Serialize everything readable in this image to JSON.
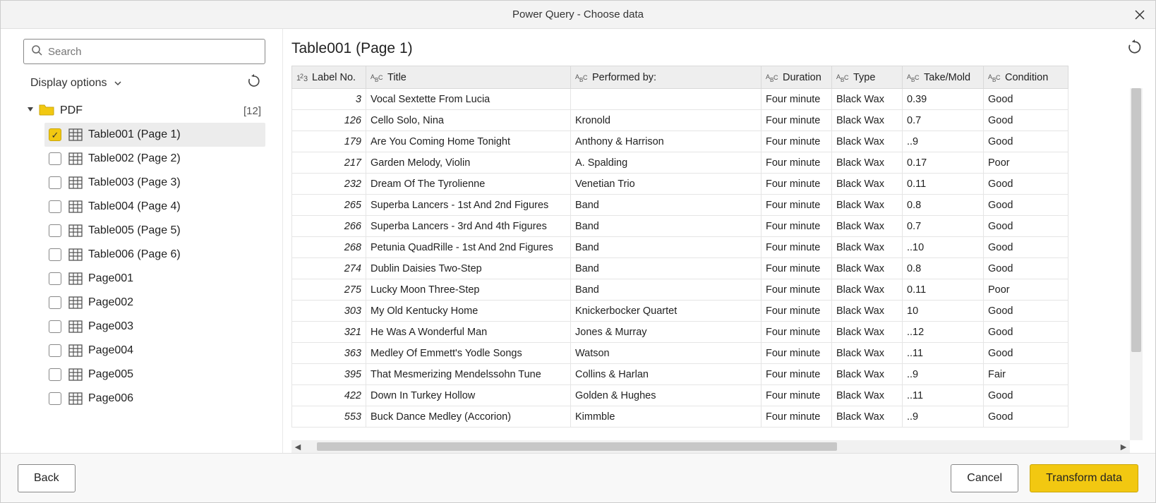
{
  "window": {
    "title": "Power Query - Choose data"
  },
  "sidebar": {
    "search_placeholder": "Search",
    "display_options_label": "Display options",
    "root": {
      "label": "PDF",
      "count": "[12]"
    },
    "items": [
      {
        "label": "Table001 (Page 1)",
        "checked": true,
        "kind": "table",
        "selected": true
      },
      {
        "label": "Table002 (Page 2)",
        "checked": false,
        "kind": "table",
        "selected": false
      },
      {
        "label": "Table003 (Page 3)",
        "checked": false,
        "kind": "table",
        "selected": false
      },
      {
        "label": "Table004 (Page 4)",
        "checked": false,
        "kind": "table",
        "selected": false
      },
      {
        "label": "Table005 (Page 5)",
        "checked": false,
        "kind": "table",
        "selected": false
      },
      {
        "label": "Table006 (Page 6)",
        "checked": false,
        "kind": "table",
        "selected": false
      },
      {
        "label": "Page001",
        "checked": false,
        "kind": "page",
        "selected": false
      },
      {
        "label": "Page002",
        "checked": false,
        "kind": "page",
        "selected": false
      },
      {
        "label": "Page003",
        "checked": false,
        "kind": "page",
        "selected": false
      },
      {
        "label": "Page004",
        "checked": false,
        "kind": "page",
        "selected": false
      },
      {
        "label": "Page005",
        "checked": false,
        "kind": "page",
        "selected": false
      },
      {
        "label": "Page006",
        "checked": false,
        "kind": "page",
        "selected": false
      }
    ]
  },
  "main": {
    "title": "Table001 (Page 1)",
    "columns": [
      {
        "label": "Label No.",
        "type": "number"
      },
      {
        "label": "Title",
        "type": "text"
      },
      {
        "label": "Performed by:",
        "type": "text"
      },
      {
        "label": "Duration",
        "type": "text"
      },
      {
        "label": "Type",
        "type": "text"
      },
      {
        "label": "Take/Mold",
        "type": "text"
      },
      {
        "label": "Condition",
        "type": "text"
      }
    ],
    "rows": [
      {
        "c0": "3",
        "c1": "Vocal Sextette From Lucia",
        "c2": "",
        "c3": "Four minute",
        "c4": "Black Wax",
        "c5": "0.39",
        "c6": "Good"
      },
      {
        "c0": "126",
        "c1": "Cello Solo, Nina",
        "c2": "Kronold",
        "c3": "Four minute",
        "c4": "Black Wax",
        "c5": "0.7",
        "c6": "Good"
      },
      {
        "c0": "179",
        "c1": "Are You Coming Home Tonight",
        "c2": "Anthony & Harrison",
        "c3": "Four minute",
        "c4": "Black Wax",
        "c5": "..9",
        "c6": "Good"
      },
      {
        "c0": "217",
        "c1": "Garden Melody, Violin",
        "c2": "A. Spalding",
        "c3": "Four minute",
        "c4": "Black Wax",
        "c5": "0.17",
        "c6": "Poor"
      },
      {
        "c0": "232",
        "c1": "Dream Of The Tyrolienne",
        "c2": "Venetian Trio",
        "c3": "Four minute",
        "c4": "Black Wax",
        "c5": "0.11",
        "c6": "Good"
      },
      {
        "c0": "265",
        "c1": "Superba Lancers - 1st And 2nd Figures",
        "c2": "Band",
        "c3": "Four minute",
        "c4": "Black Wax",
        "c5": "0.8",
        "c6": "Good"
      },
      {
        "c0": "266",
        "c1": "Superba Lancers - 3rd And 4th Figures",
        "c2": "Band",
        "c3": "Four minute",
        "c4": "Black Wax",
        "c5": "0.7",
        "c6": "Good"
      },
      {
        "c0": "268",
        "c1": "Petunia QuadRille - 1st And 2nd Figures",
        "c2": "Band",
        "c3": "Four minute",
        "c4": "Black Wax",
        "c5": "..10",
        "c6": "Good"
      },
      {
        "c0": "274",
        "c1": "Dublin Daisies Two-Step",
        "c2": "Band",
        "c3": "Four minute",
        "c4": "Black Wax",
        "c5": "0.8",
        "c6": "Good"
      },
      {
        "c0": "275",
        "c1": "Lucky Moon Three-Step",
        "c2": "Band",
        "c3": "Four minute",
        "c4": "Black Wax",
        "c5": "0.11",
        "c6": "Poor"
      },
      {
        "c0": "303",
        "c1": "My Old Kentucky Home",
        "c2": "Knickerbocker Quartet",
        "c3": "Four minute",
        "c4": "Black Wax",
        "c5": "10",
        "c6": "Good"
      },
      {
        "c0": "321",
        "c1": "He Was A Wonderful Man",
        "c2": "Jones & Murray",
        "c3": "Four minute",
        "c4": "Black Wax",
        "c5": "..12",
        "c6": "Good"
      },
      {
        "c0": "363",
        "c1": "Medley Of Emmett's Yodle Songs",
        "c2": "Watson",
        "c3": "Four minute",
        "c4": "Black Wax",
        "c5": "..11",
        "c6": "Good"
      },
      {
        "c0": "395",
        "c1": "That Mesmerizing Mendelssohn Tune",
        "c2": "Collins & Harlan",
        "c3": "Four minute",
        "c4": "Black Wax",
        "c5": "..9",
        "c6": "Fair"
      },
      {
        "c0": "422",
        "c1": "Down In Turkey Hollow",
        "c2": "Golden & Hughes",
        "c3": "Four minute",
        "c4": "Black Wax",
        "c5": "..11",
        "c6": "Good"
      },
      {
        "c0": "553",
        "c1": "Buck Dance Medley (Accorion)",
        "c2": "Kimmble",
        "c3": "Four minute",
        "c4": "Black Wax",
        "c5": "..9",
        "c6": "Good"
      }
    ]
  },
  "footer": {
    "back_label": "Back",
    "cancel_label": "Cancel",
    "transform_label": "Transform data"
  }
}
